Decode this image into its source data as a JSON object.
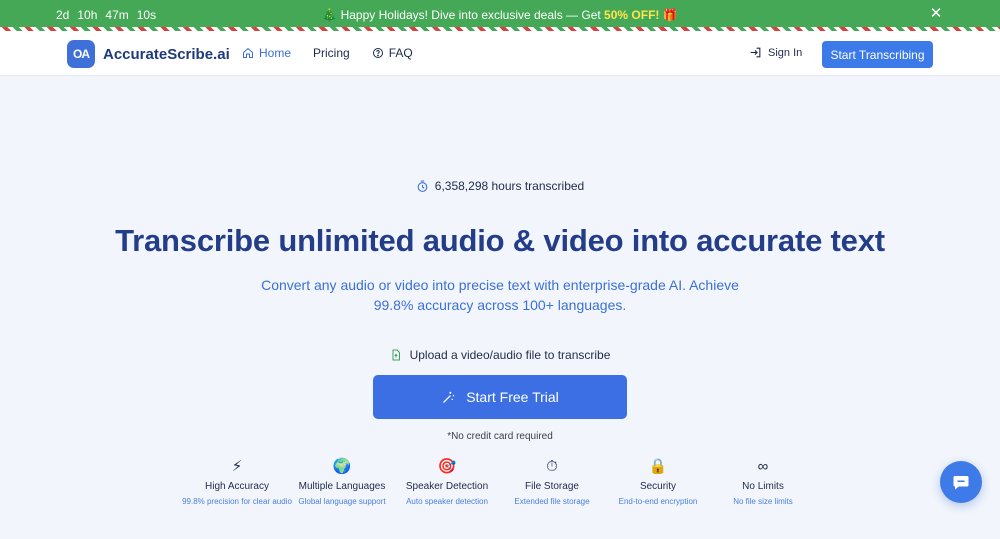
{
  "promo": {
    "countdown": [
      "2d",
      "10h",
      "47m",
      "10s"
    ],
    "message_prefix": "🎄 Happy Holidays! Dive into exclusive deals — Get ",
    "message_highlight": "50% OFF!",
    "message_suffix": " 🎁",
    "close_glyph": "✕",
    "bg_color": "#44a856",
    "highlight_color": "#ffe54c"
  },
  "nav": {
    "logo_mark": "OA",
    "logo_text": "AccurateScribe.ai",
    "links": [
      {
        "label": "Home",
        "icon": "home-icon"
      },
      {
        "label": "Pricing",
        "icon": ""
      },
      {
        "label": "FAQ",
        "icon": "help-circle-icon"
      }
    ],
    "signin_label": "Sign In",
    "cta_label": "Start Transcribing",
    "accent_color": "#3b7ae8"
  },
  "hero": {
    "stat": "6,358,298 hours transcribed",
    "title": "Transcribe unlimited audio & video into accurate text",
    "subtitle": "Convert any audio or video into precise text with enterprise-grade AI. Achieve 99.8% accuracy across 100+ languages.",
    "upload_label": "Upload a video/audio file to transcribe",
    "cta_label": "Start Free Trial",
    "no_cc": "*No credit card required",
    "title_color": "#233d88"
  },
  "features": [
    {
      "icon": "⚡",
      "icon_name": "lightning-icon",
      "title": "High Accuracy",
      "desc": "99.8% precision for clear audio"
    },
    {
      "icon": "🌍",
      "icon_name": "globe-icon",
      "title": "Multiple Languages",
      "desc": "Global language support"
    },
    {
      "icon": "🎯",
      "icon_name": "target-icon",
      "title": "Speaker Detection",
      "desc": "Auto speaker detection"
    },
    {
      "icon": "⏱",
      "icon_name": "stopwatch-icon",
      "title": "File Storage",
      "desc": "Extended file storage"
    },
    {
      "icon": "🔒",
      "icon_name": "lock-icon",
      "title": "Security",
      "desc": "End-to-end encryption"
    },
    {
      "icon": "∞",
      "icon_name": "infinity-icon",
      "title": "No Limits",
      "desc": "No file size limits"
    }
  ]
}
